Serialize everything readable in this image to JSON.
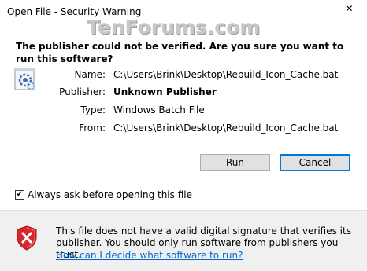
{
  "window": {
    "title": "Open File - Security Warning",
    "close_glyph": "✕"
  },
  "watermark": "TenForums.com",
  "dialog": {
    "question": "The publisher could not be verified.  Are you sure you want to run this software?",
    "fields": {
      "name_label": "Name:",
      "name_value": "C:\\Users\\Brink\\Desktop\\Rebuild_Icon_Cache.bat",
      "publisher_label": "Publisher:",
      "publisher_value": "Unknown Publisher",
      "type_label": "Type:",
      "type_value": "Windows Batch File",
      "from_label": "From:",
      "from_value": "C:\\Users\\Brink\\Desktop\\Rebuild_Icon_Cache.bat"
    },
    "buttons": {
      "run": "Run",
      "cancel": "Cancel"
    },
    "checkbox": {
      "label": "Always ask before opening this file",
      "checked": true,
      "check_glyph": "✔"
    }
  },
  "footer": {
    "warning_text": "This file does not have a valid digital signature that verifies its publisher.  You should only run software from publishers you trust.",
    "help_link": "How can I decide what software to run?"
  },
  "icons": {
    "file": "batch-file-gear-icon",
    "shield": "security-shield-error-icon"
  },
  "colors": {
    "accent": "#0078d7",
    "link": "#0066cc",
    "shield_red": "#d8262b"
  }
}
